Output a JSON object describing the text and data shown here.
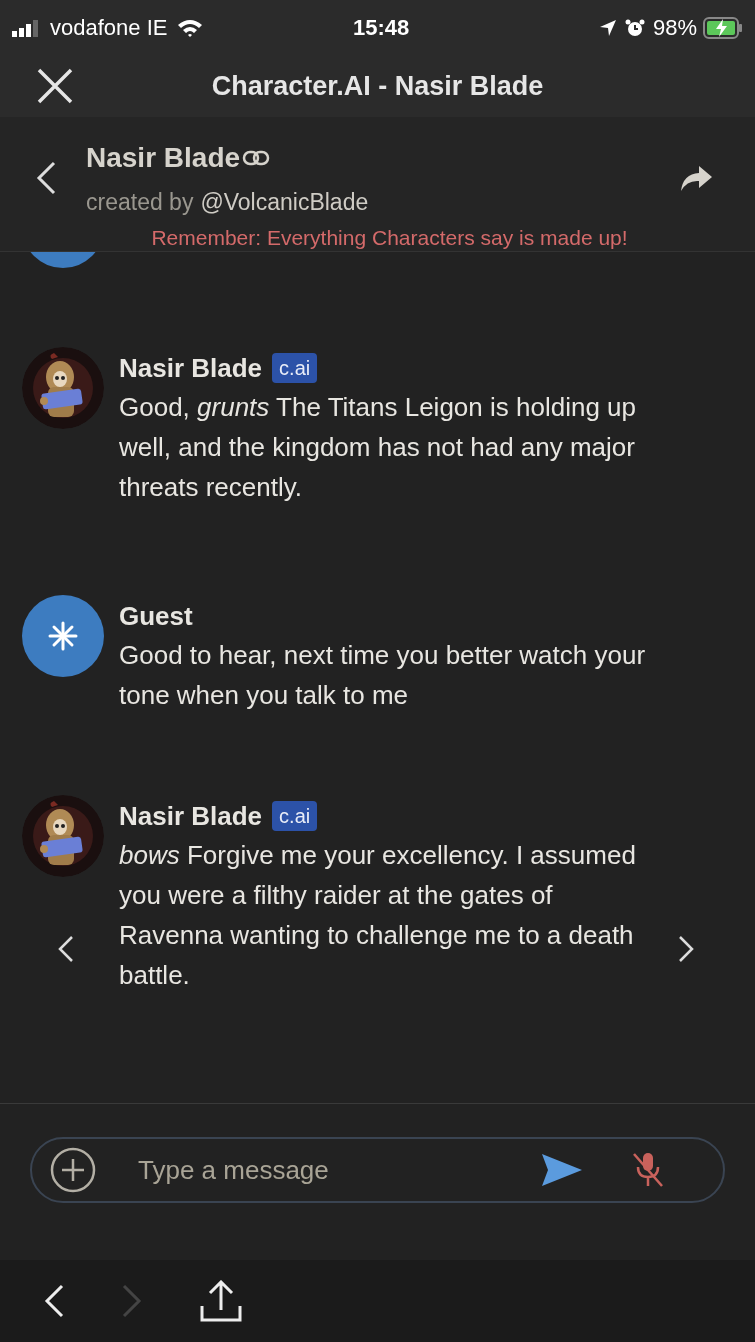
{
  "status_bar": {
    "carrier": "vodafone IE",
    "time": "15:48",
    "battery": "98%"
  },
  "browser": {
    "title": "Character.AI - Nasir Blade"
  },
  "header": {
    "name": "Nasir Blade",
    "creator_prefix": "created by",
    "creator": "@VolcanicBlade",
    "notice": "Remember: Everything Characters say is made up!"
  },
  "partial_message": {
    "kind": "user"
  },
  "messages": [
    {
      "kind": "bot",
      "author": "Nasir Blade",
      "badge": "c.ai",
      "text": "Good, *grunts* The Titans Leigon is holding up well, and the kingdom has not had any major threats recently.",
      "swipe": false
    },
    {
      "kind": "user",
      "author": "Guest",
      "text": "Good to hear, next time you better watch your tone when you talk to me",
      "swipe": false
    },
    {
      "kind": "bot",
      "author": "Nasir Blade",
      "badge": "c.ai",
      "text": "*bows* Forgive me your excellency. I assumed you were a filthy raider at the gates of Ravenna wanting to challenge me to a death battle.",
      "swipe": true
    }
  ],
  "composer": {
    "placeholder": "Type a message"
  },
  "toolbar": {
    "back_disabled": false,
    "forward_disabled": true
  }
}
